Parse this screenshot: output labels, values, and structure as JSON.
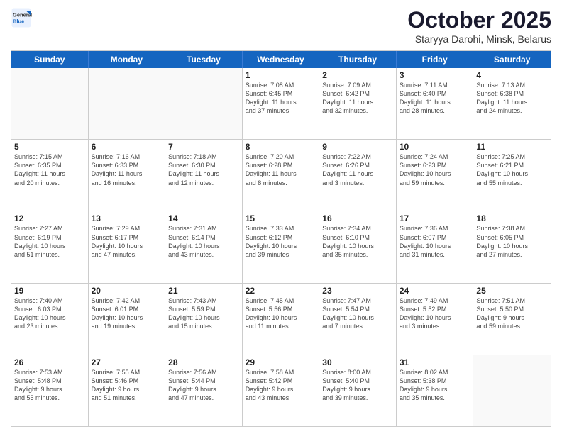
{
  "header": {
    "logo_general": "General",
    "logo_blue": "Blue",
    "month": "October 2025",
    "location": "Staryya Darohi, Minsk, Belarus"
  },
  "weekdays": [
    "Sunday",
    "Monday",
    "Tuesday",
    "Wednesday",
    "Thursday",
    "Friday",
    "Saturday"
  ],
  "rows": [
    [
      {
        "day": "",
        "text": ""
      },
      {
        "day": "",
        "text": ""
      },
      {
        "day": "",
        "text": ""
      },
      {
        "day": "1",
        "text": "Sunrise: 7:08 AM\nSunset: 6:45 PM\nDaylight: 11 hours\nand 37 minutes."
      },
      {
        "day": "2",
        "text": "Sunrise: 7:09 AM\nSunset: 6:42 PM\nDaylight: 11 hours\nand 32 minutes."
      },
      {
        "day": "3",
        "text": "Sunrise: 7:11 AM\nSunset: 6:40 PM\nDaylight: 11 hours\nand 28 minutes."
      },
      {
        "day": "4",
        "text": "Sunrise: 7:13 AM\nSunset: 6:38 PM\nDaylight: 11 hours\nand 24 minutes."
      }
    ],
    [
      {
        "day": "5",
        "text": "Sunrise: 7:15 AM\nSunset: 6:35 PM\nDaylight: 11 hours\nand 20 minutes."
      },
      {
        "day": "6",
        "text": "Sunrise: 7:16 AM\nSunset: 6:33 PM\nDaylight: 11 hours\nand 16 minutes."
      },
      {
        "day": "7",
        "text": "Sunrise: 7:18 AM\nSunset: 6:30 PM\nDaylight: 11 hours\nand 12 minutes."
      },
      {
        "day": "8",
        "text": "Sunrise: 7:20 AM\nSunset: 6:28 PM\nDaylight: 11 hours\nand 8 minutes."
      },
      {
        "day": "9",
        "text": "Sunrise: 7:22 AM\nSunset: 6:26 PM\nDaylight: 11 hours\nand 3 minutes."
      },
      {
        "day": "10",
        "text": "Sunrise: 7:24 AM\nSunset: 6:23 PM\nDaylight: 10 hours\nand 59 minutes."
      },
      {
        "day": "11",
        "text": "Sunrise: 7:25 AM\nSunset: 6:21 PM\nDaylight: 10 hours\nand 55 minutes."
      }
    ],
    [
      {
        "day": "12",
        "text": "Sunrise: 7:27 AM\nSunset: 6:19 PM\nDaylight: 10 hours\nand 51 minutes."
      },
      {
        "day": "13",
        "text": "Sunrise: 7:29 AM\nSunset: 6:17 PM\nDaylight: 10 hours\nand 47 minutes."
      },
      {
        "day": "14",
        "text": "Sunrise: 7:31 AM\nSunset: 6:14 PM\nDaylight: 10 hours\nand 43 minutes."
      },
      {
        "day": "15",
        "text": "Sunrise: 7:33 AM\nSunset: 6:12 PM\nDaylight: 10 hours\nand 39 minutes."
      },
      {
        "day": "16",
        "text": "Sunrise: 7:34 AM\nSunset: 6:10 PM\nDaylight: 10 hours\nand 35 minutes."
      },
      {
        "day": "17",
        "text": "Sunrise: 7:36 AM\nSunset: 6:07 PM\nDaylight: 10 hours\nand 31 minutes."
      },
      {
        "day": "18",
        "text": "Sunrise: 7:38 AM\nSunset: 6:05 PM\nDaylight: 10 hours\nand 27 minutes."
      }
    ],
    [
      {
        "day": "19",
        "text": "Sunrise: 7:40 AM\nSunset: 6:03 PM\nDaylight: 10 hours\nand 23 minutes."
      },
      {
        "day": "20",
        "text": "Sunrise: 7:42 AM\nSunset: 6:01 PM\nDaylight: 10 hours\nand 19 minutes."
      },
      {
        "day": "21",
        "text": "Sunrise: 7:43 AM\nSunset: 5:59 PM\nDaylight: 10 hours\nand 15 minutes."
      },
      {
        "day": "22",
        "text": "Sunrise: 7:45 AM\nSunset: 5:56 PM\nDaylight: 10 hours\nand 11 minutes."
      },
      {
        "day": "23",
        "text": "Sunrise: 7:47 AM\nSunset: 5:54 PM\nDaylight: 10 hours\nand 7 minutes."
      },
      {
        "day": "24",
        "text": "Sunrise: 7:49 AM\nSunset: 5:52 PM\nDaylight: 10 hours\nand 3 minutes."
      },
      {
        "day": "25",
        "text": "Sunrise: 7:51 AM\nSunset: 5:50 PM\nDaylight: 9 hours\nand 59 minutes."
      }
    ],
    [
      {
        "day": "26",
        "text": "Sunrise: 7:53 AM\nSunset: 5:48 PM\nDaylight: 9 hours\nand 55 minutes."
      },
      {
        "day": "27",
        "text": "Sunrise: 7:55 AM\nSunset: 5:46 PM\nDaylight: 9 hours\nand 51 minutes."
      },
      {
        "day": "28",
        "text": "Sunrise: 7:56 AM\nSunset: 5:44 PM\nDaylight: 9 hours\nand 47 minutes."
      },
      {
        "day": "29",
        "text": "Sunrise: 7:58 AM\nSunset: 5:42 PM\nDaylight: 9 hours\nand 43 minutes."
      },
      {
        "day": "30",
        "text": "Sunrise: 8:00 AM\nSunset: 5:40 PM\nDaylight: 9 hours\nand 39 minutes."
      },
      {
        "day": "31",
        "text": "Sunrise: 8:02 AM\nSunset: 5:38 PM\nDaylight: 9 hours\nand 35 minutes."
      },
      {
        "day": "",
        "text": ""
      }
    ]
  ]
}
